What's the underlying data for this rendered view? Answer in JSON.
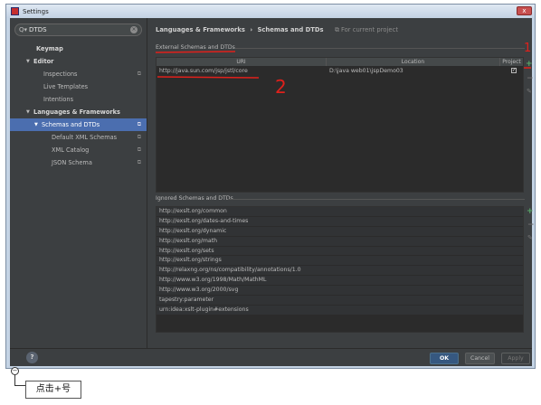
{
  "window": {
    "title": "Settings",
    "close_label": "x"
  },
  "search": {
    "value": "DTDS",
    "placeholder": ""
  },
  "sidebar": {
    "items": [
      {
        "label": "Keymap"
      },
      {
        "label": "Editor"
      },
      {
        "label": "Inspections"
      },
      {
        "label": "Live Templates"
      },
      {
        "label": "Intentions"
      },
      {
        "label": "Languages & Frameworks"
      },
      {
        "label": "Schemas and DTDs"
      },
      {
        "label": "Default XML Schemas"
      },
      {
        "label": "XML Catalog"
      },
      {
        "label": "JSON Schema"
      }
    ]
  },
  "breadcrumb": {
    "parent": "Languages & Frameworks",
    "separator": "›",
    "current": "Schemas and DTDs",
    "scope": "For current project"
  },
  "external": {
    "label": "External Schemas and DTDs",
    "columns": [
      "URI",
      "Location",
      "Project"
    ],
    "rows": [
      {
        "uri": "http://java.sun.com/jsp/jstl/core",
        "location": "D:\\java web01\\jspDemo03",
        "project": true
      }
    ]
  },
  "ignored": {
    "label": "Ignored Schemas and DTDs",
    "rows": [
      "http://exslt.org/common",
      "http://exslt.org/dates-and-times",
      "http://exslt.org/dynamic",
      "http://exslt.org/math",
      "http://exslt.org/sets",
      "http://exslt.org/strings",
      "http://relaxng.org/ns/compatibility/annotations/1.0",
      "http://www.w3.org/1998/Math/MathML",
      "http://www.w3.org/2000/svg",
      "tapestry:parameter",
      "urn:idea:xslt-plugin#extensions"
    ]
  },
  "footer": {
    "help": "?",
    "ok": "OK",
    "cancel": "Cancel",
    "apply": "Apply"
  },
  "annotations": {
    "mark1": "1",
    "mark2": "2",
    "callout_text": "点击+号",
    "callout_symbol": "−"
  },
  "colors": {
    "selection": "#4b6eaf",
    "add": "#59a869",
    "annotation": "#e0201b"
  }
}
